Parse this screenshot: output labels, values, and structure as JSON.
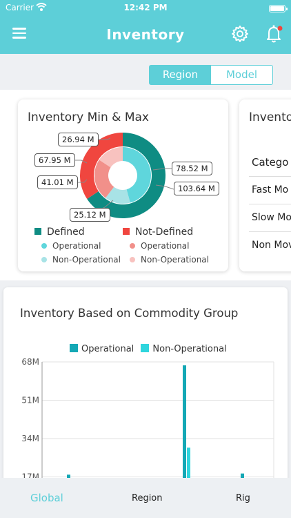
{
  "status_bar": {
    "carrier": "Carrier",
    "time": "12:42 PM"
  },
  "header": {
    "title": "Inventory"
  },
  "segment": {
    "options": [
      "Region",
      "Model"
    ],
    "selected": "Region"
  },
  "card_min_max": {
    "title": "Inventory Min & Max",
    "callouts": [
      "26.94 M",
      "67.95 M",
      "41.01 M",
      "25.12 M",
      "78.52 M",
      "103.64 M"
    ],
    "legend": {
      "defined": "Defined",
      "not_defined": "Not-Defined",
      "defined_operational": "Operational",
      "not_defined_operational": "Operational",
      "defined_non_operational": "Non-Operational",
      "not_defined_non_operational": "Non-Operational"
    },
    "colors": {
      "defined": "#0f8c83",
      "not_defined": "#f0463f",
      "defined_operational": "#5fd6dc",
      "defined_non_operational": "#a8e3e6",
      "not_defined_operational": "#f1908a",
      "not_defined_non_operational": "#f8c2bf"
    }
  },
  "card_category": {
    "title": "Invento",
    "header": "Catego",
    "rows": [
      "Fast Mo",
      "Slow Mo",
      "Non Mov"
    ]
  },
  "commodity_chart": {
    "title": "Inventory Based on Commodity Group",
    "legend": [
      "Operational",
      "Non-Operational"
    ],
    "colors": {
      "operational": "#14a8b5",
      "non_operational": "#2fd5dd"
    },
    "y_ticks": [
      "68M",
      "51M",
      "34M",
      "17M"
    ]
  },
  "chart_data": [
    {
      "type": "pie",
      "title": "Inventory Min & Max",
      "outer_ring": [
        {
          "label": "Defined",
          "value": 182.16
        },
        {
          "label": "Not-Defined",
          "value": 94.89
        }
      ],
      "inner_ring": [
        {
          "label": "Defined Operational",
          "value": 78.52
        },
        {
          "label": "Defined Non-Operational",
          "value": 25.12
        },
        {
          "label": "Not-Defined Operational",
          "value": 41.01
        },
        {
          "label": "Not-Defined Non-Operational",
          "value": 26.94
        }
      ]
    },
    {
      "type": "bar",
      "title": "Inventory Based on Commodity Group",
      "ylim": [
        0,
        68
      ],
      "y_unit": "M",
      "series": [
        {
          "name": "Operational",
          "values": [
            18,
            66.5,
            18.5
          ]
        },
        {
          "name": "Non-Operational",
          "values": [
            0,
            30,
            0
          ]
        }
      ]
    }
  ],
  "tabbar": {
    "tabs": [
      "Global",
      "Region",
      "Rig"
    ],
    "active": "Global"
  }
}
